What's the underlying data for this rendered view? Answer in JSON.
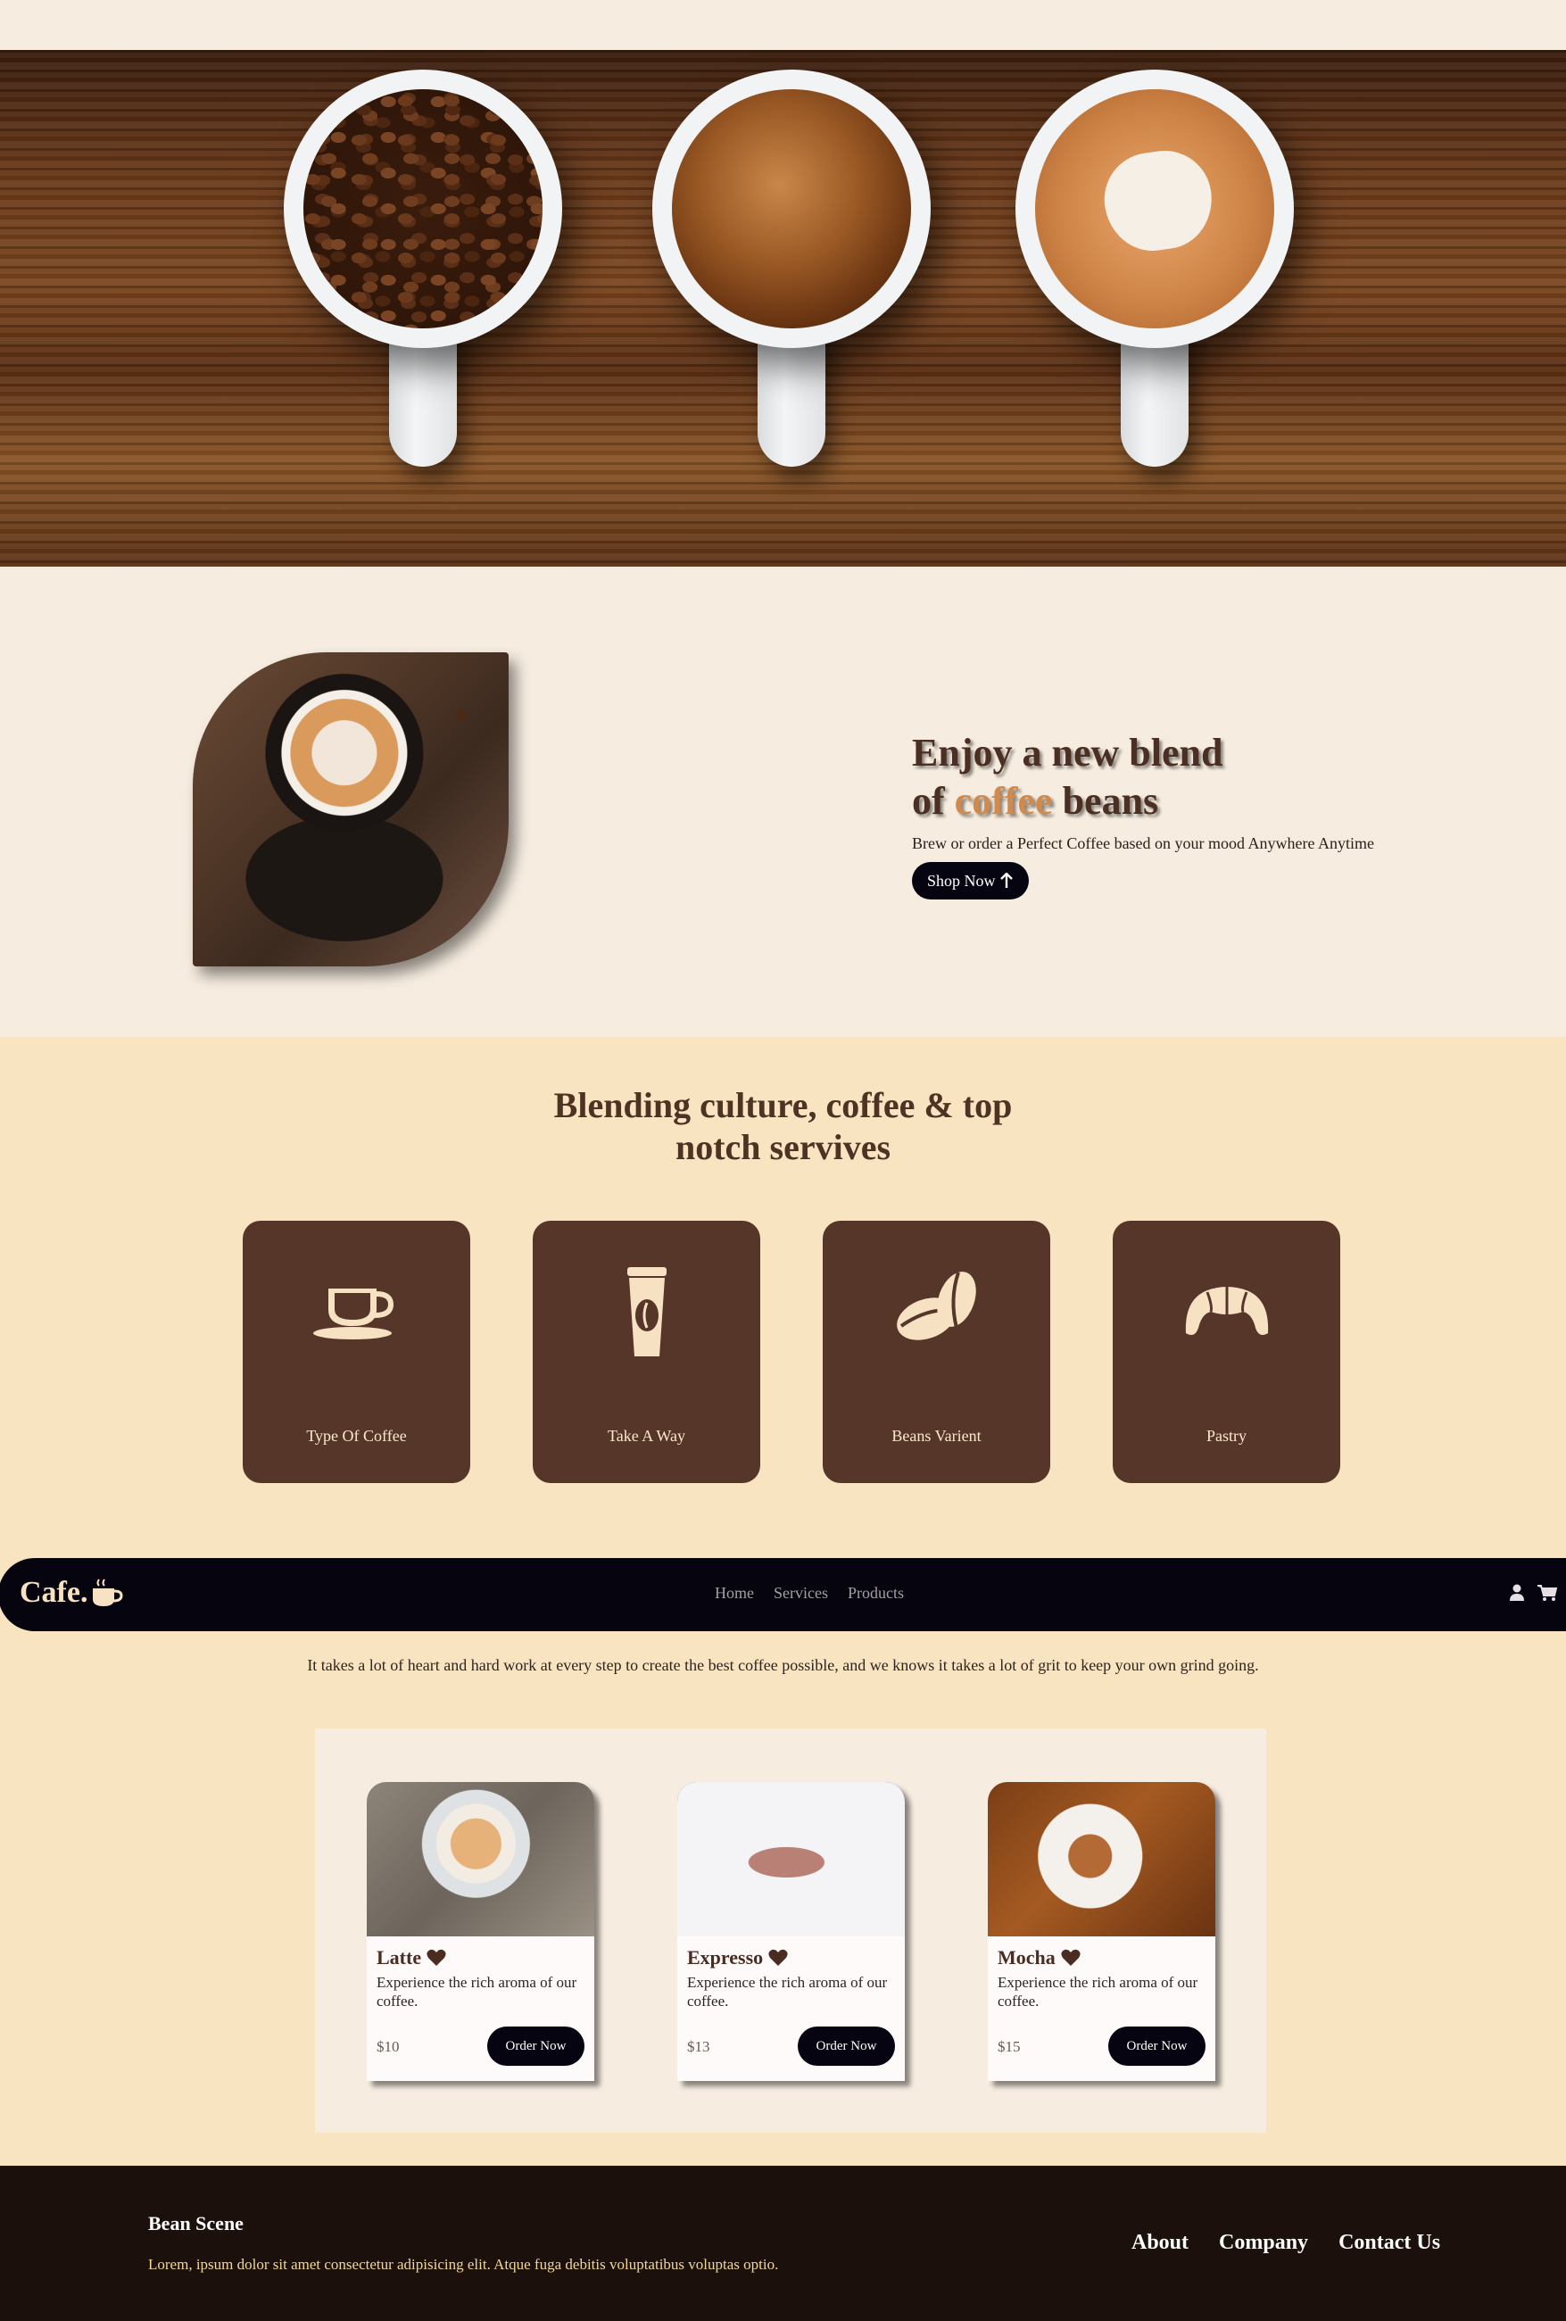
{
  "hero": {
    "alt": "Three coffee cups on wooden table"
  },
  "feature": {
    "title_line1": "Enjoy a new blend",
    "title_of": "of",
    "title_highlight": "coffee",
    "title_end": "beans",
    "subtitle": "Brew or order a Perfect Coffee based on your mood Anywhere Anytime",
    "button_label": "Shop Now",
    "accent": "#d08a4d"
  },
  "services": {
    "title_line1": "Blending culture, coffee & top",
    "title_line2": "notch servives",
    "items": [
      {
        "label": "Type Of Coffee",
        "icon": "coffee-cup-icon"
      },
      {
        "label": "Take A Way",
        "icon": "takeaway-cup-icon"
      },
      {
        "label": "Beans Varient",
        "icon": "coffee-bean-icon"
      },
      {
        "label": "Pastry",
        "icon": "croissant-icon"
      }
    ]
  },
  "navbar": {
    "logo": "Cafe.",
    "links": [
      "Home",
      "Services",
      "Products"
    ]
  },
  "products": {
    "subtitle": "It takes a lot of heart and hard work at every step to create the best coffee possible, and we knows it takes a lot of grit to keep your own grind going.",
    "order_label": "Order Now",
    "items": [
      {
        "name": "Latte",
        "desc": "Experience the rich aroma of our coffee.",
        "price": "$10"
      },
      {
        "name": "Expresso",
        "desc": "Experience the rich aroma of our coffee.",
        "price": "$13"
      },
      {
        "name": "Mocha",
        "desc": "Experience the rich aroma of our coffee.",
        "price": "$15"
      }
    ]
  },
  "footer": {
    "brand": "Bean Scene",
    "text": "Lorem, ipsum dolor sit amet consectetur adipisicing elit. Atque fuga debitis voluptatibus voluptas optio.",
    "links": [
      "About",
      "Company",
      "Contact Us"
    ]
  },
  "colors": {
    "background": "#f6ede0",
    "services_bg": "#f8e4c0",
    "card_brown": "#563629",
    "navbar": "#05040f",
    "footer": "#1b100b"
  }
}
